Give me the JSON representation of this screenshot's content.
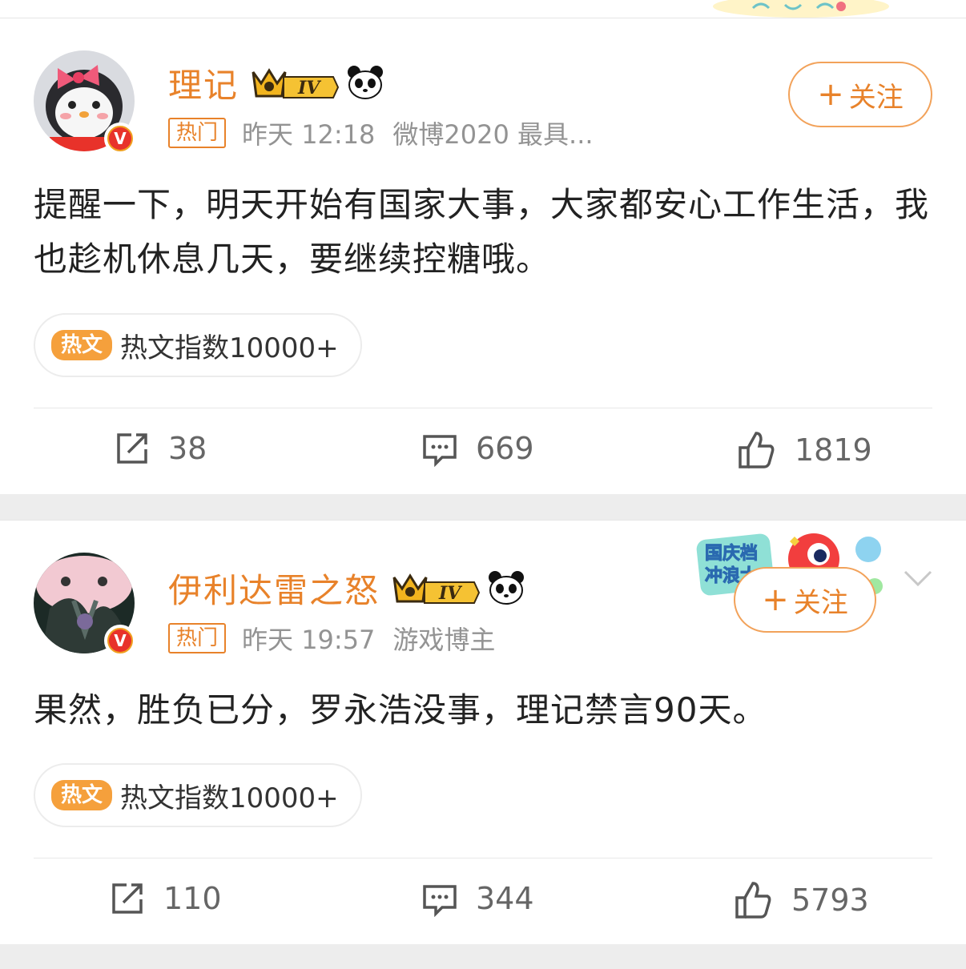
{
  "posts": [
    {
      "username": "理记",
      "level": "IV",
      "hot_tag": "热门",
      "time": "昨天 12:18",
      "source": "微博2020 最具...",
      "follow_label": "关注",
      "content": "提醒一下，明天开始有国家大事，大家都安心工作生活，我也趁机休息几天，要继续控糖哦。",
      "hot_badge": "热文",
      "hot_index": "热文指数10000+",
      "reposts": "38",
      "comments": "669",
      "likes": "1819"
    },
    {
      "username": "伊利达雷之怒",
      "level": "IV",
      "hot_tag": "热门",
      "time": "昨天 19:57",
      "source": "游戏博主",
      "follow_label": "关注",
      "promo_text": "国庆档 冲浪大",
      "content": "果然，胜负已分，罗永浩没事，理记禁言90天。",
      "hot_badge": "热文",
      "hot_index": "热文指数10000+",
      "reposts": "110",
      "comments": "344",
      "likes": "5793"
    }
  ],
  "colors": {
    "accent": "#e8822a",
    "verified": "#f0a020",
    "hot_badge": "#f5a03c",
    "text": "#222222",
    "meta": "#939393",
    "background": "#ededed"
  },
  "icons": [
    "repost-icon",
    "comment-icon",
    "like-icon",
    "crown-icon",
    "panda-icon",
    "chevron-down-icon",
    "verified-icon"
  ]
}
